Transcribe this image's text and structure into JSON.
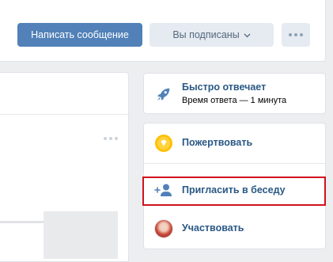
{
  "header": {
    "message_button": "Написать сообщение",
    "subscribed_button": "Вы подписаны",
    "subscribed_chevron": "⌵",
    "more_button_icon": "more-dots-icon"
  },
  "fast_reply": {
    "title": "Быстро отвечает",
    "subtitle": "Время ответа — 1 минута",
    "icon": "rocket-icon"
  },
  "actions": [
    {
      "label": "Пожертвовать",
      "icon": "donate-coin-icon"
    },
    {
      "label": "Пригласить в беседу",
      "icon": "add-user-icon"
    },
    {
      "label": "Участвовать",
      "icon": "avatar"
    }
  ],
  "colors": {
    "primary": "#5181b8",
    "link": "#2a5885",
    "highlight": "#d0121e",
    "coin": "#ffc000"
  }
}
